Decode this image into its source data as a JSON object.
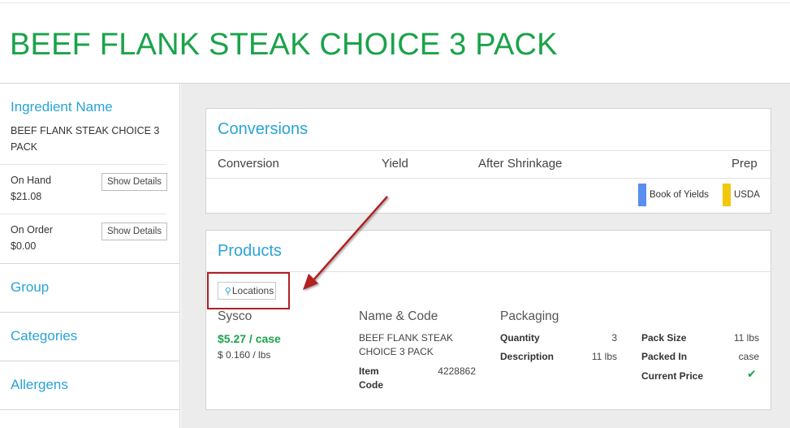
{
  "page": {
    "title": "BEEF FLANK STEAK CHOICE 3 PACK"
  },
  "sidebar": {
    "ingredient_name_heading": "Ingredient Name",
    "ingredient_name_line1": "BEEF FLANK STEAK CHOICE 3",
    "ingredient_name_line2": "PACK",
    "on_hand_label": "On Hand",
    "on_hand_value": "$21.08",
    "on_order_label": "On Order",
    "on_order_value": "$0.00",
    "show_details_label": "Show Details",
    "group": "Group",
    "categories": "Categories",
    "allergens": "Allergens"
  },
  "conversions": {
    "title": "Conversions",
    "columns": [
      "Conversion",
      "Yield",
      "After Shrinkage",
      "Prep"
    ],
    "legend": [
      {
        "label": "Book of Yields",
        "color": "#5b8def"
      },
      {
        "label": "USDA",
        "color": "#f2c70d"
      }
    ]
  },
  "products": {
    "title": "Products",
    "locations_button": "Locations",
    "vendor": "Sysco",
    "price_case": "$5.27 / case",
    "price_lbs": "$ 0.160 / lbs",
    "name_code_heading": "Name & Code",
    "product_name_line1": "BEEF FLANK STEAK",
    "product_name_line2": "CHOICE 3 PACK",
    "item_code_label_line1": "Item",
    "item_code_label_line2": "Code",
    "item_code_value": "4228862",
    "packaging_heading": "Packaging",
    "quantity_label": "Quantity",
    "quantity_value": "3",
    "description_label": "Description",
    "description_value": "11 lbs",
    "pack_size_label": "Pack Size",
    "pack_size_value": "11 lbs",
    "packed_in_label": "Packed In",
    "packed_in_value": "case",
    "current_price_label": "Current Price",
    "current_price_icon": "check-icon"
  },
  "colors": {
    "accent_green": "#1aa34a",
    "accent_blue": "#29a3d8",
    "annotation_red": "#b02024"
  }
}
